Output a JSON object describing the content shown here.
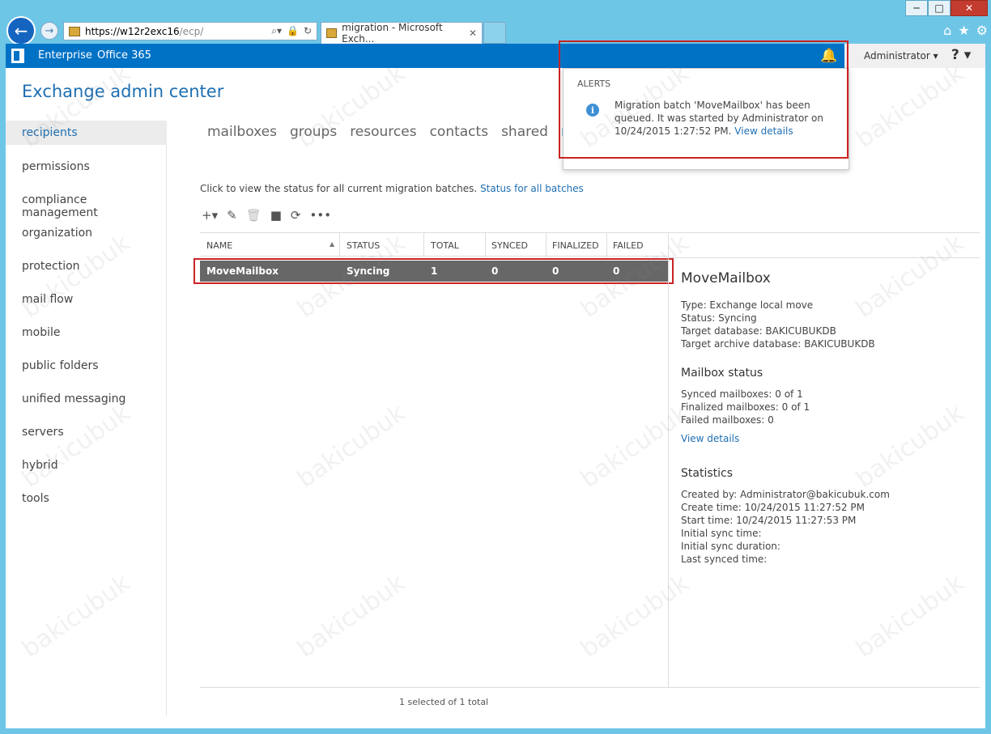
{
  "browser": {
    "url_host": "https://w12r2exc16",
    "url_path": "/ecp/",
    "tab_title": "migration - Microsoft Exch...",
    "win_minimize": "─",
    "win_maximize": "□",
    "win_close": "✕"
  },
  "topbar": {
    "enterprise": "Enterprise",
    "office365": "Office 365",
    "user": "Administrator ▾",
    "help": "? ▾"
  },
  "app_title": "Exchange admin center",
  "leftnav": [
    "recipients",
    "permissions",
    "compliance management",
    "organization",
    "protection",
    "mail flow",
    "mobile",
    "public folders",
    "unified messaging",
    "servers",
    "hybrid",
    "tools"
  ],
  "subtabs": [
    "mailboxes",
    "groups",
    "resources",
    "contacts",
    "shared",
    "migra"
  ],
  "hint": {
    "text": "Click to view the status for all current migration batches.",
    "link": "Status for all batches"
  },
  "grid": {
    "columns": [
      "NAME",
      "STATUS",
      "TOTAL",
      "SYNCED",
      "FINALIZED",
      "FAILED"
    ],
    "rows": [
      {
        "name": "MoveMailbox",
        "status": "Syncing",
        "total": "1",
        "synced": "0",
        "finalized": "0",
        "failed": "0"
      }
    ],
    "footer": "1 selected of 1 total"
  },
  "details": {
    "title": "MoveMailbox",
    "type": "Type: Exchange local move",
    "status": "Status: Syncing",
    "target_db": "Target database: BAKICUBUKDB",
    "target_archive_db": "Target archive database: BAKICUBUKDB",
    "mailbox_status_heading": "Mailbox status",
    "synced": "Synced mailboxes: 0 of 1",
    "finalized": "Finalized mailboxes: 0 of 1",
    "failed": "Failed mailboxes: 0",
    "view_details": "View details",
    "statistics_heading": "Statistics",
    "created_by": "Created by: Administrator@bakicubuk.com",
    "create_time": "Create time: 10/24/2015 11:27:52 PM",
    "start_time": "Start time: 10/24/2015 11:27:53 PM",
    "initial_sync_time": "Initial sync time:",
    "initial_sync_duration": "Initial sync duration:",
    "last_synced_time": "Last synced time:"
  },
  "alert": {
    "heading": "ALERTS",
    "message": "Migration batch 'MoveMailbox' has been queued. It was started by Administrator on 10/24/2015 1:27:52 PM.",
    "link": "View details"
  },
  "watermark": "bakicubuk",
  "icons": {
    "back": "back-arrow-icon",
    "forward": "forward-arrow-icon",
    "bell": "bell-icon",
    "add": "plus-icon",
    "edit": "pencil-icon",
    "delete": "trash-icon",
    "stop": "stop-icon",
    "refresh": "refresh-icon",
    "more": "more-icon",
    "info": "info-icon",
    "home": "home-icon",
    "favorites": "star-icon",
    "settings": "gear-icon"
  },
  "colors": {
    "accent": "#0072c6",
    "link": "#1e6fb3",
    "selected_row": "#676767",
    "highlight_border": "#cc2222"
  }
}
